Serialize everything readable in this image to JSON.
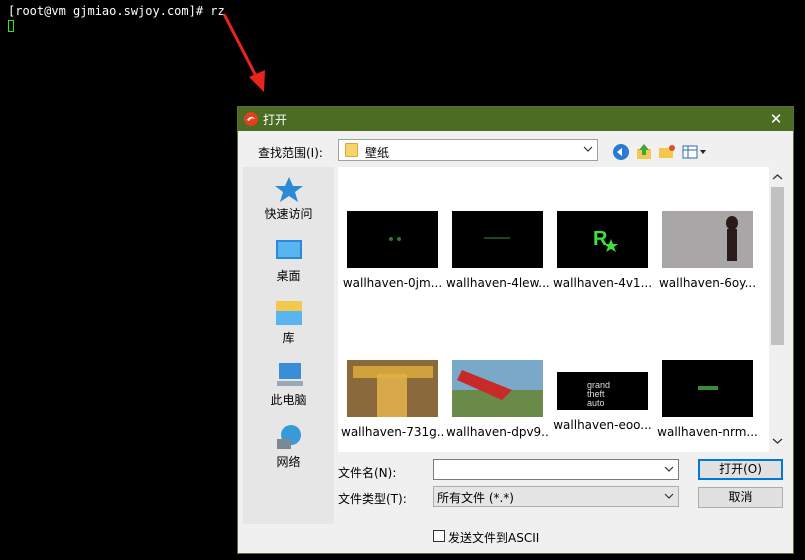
{
  "terminal": {
    "prompt_line": "[root@vm gjmiao.swjoy.com]# rz"
  },
  "dialog": {
    "title": "打开",
    "close_label": "✕",
    "look_in_label": "查找范围(I):",
    "look_in_value": "壁纸",
    "places": [
      {
        "label": "快速访问",
        "icon": "star-icon"
      },
      {
        "label": "桌面",
        "icon": "desktop-icon"
      },
      {
        "label": "库",
        "icon": "library-icon"
      },
      {
        "label": "此电脑",
        "icon": "computer-icon"
      },
      {
        "label": "网络",
        "icon": "network-icon"
      }
    ],
    "files": [
      {
        "name": "wallhaven-0jm..."
      },
      {
        "name": "wallhaven-4lew..."
      },
      {
        "name": "wallhaven-4v1..."
      },
      {
        "name": "wallhaven-6oy..."
      },
      {
        "name": "wallhaven-731g..."
      },
      {
        "name": "wallhaven-dpv9..."
      },
      {
        "name": "wallhaven-eoo..."
      },
      {
        "name": "wallhaven-nrm..."
      }
    ],
    "file_name_label": "文件名(N):",
    "file_name_value": "",
    "file_type_label": "文件类型(T):",
    "file_type_value": "所有文件 (*.*)",
    "open_button": "打开(O)",
    "cancel_button": "取消",
    "ascii_checkbox_label": "发送文件到ASCII",
    "ascii_checked": false
  },
  "colors": {
    "title_bar": "#4c6c24",
    "arrow": "#e8241c",
    "cursor": "#2ee52e"
  }
}
